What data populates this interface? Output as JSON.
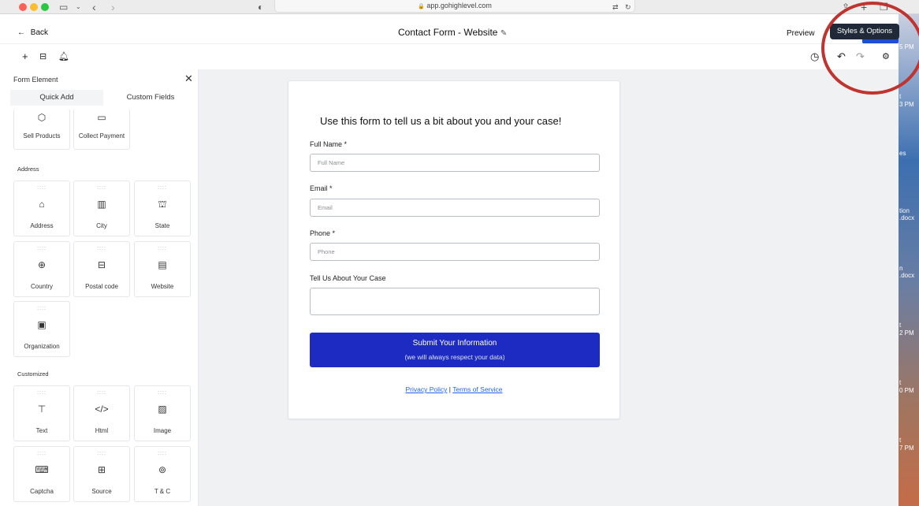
{
  "browser": {
    "url": "app.gohighlevel.com",
    "lock_icon": "🔒"
  },
  "desktop_labels": [
    "5 PM",
    "t",
    "3 PM",
    "es",
    "tion",
    ".docx",
    "n",
    ".docx",
    "t",
    "2 PM",
    "t",
    "0 PM",
    "t",
    "7 PM"
  ],
  "header": {
    "back_label": "Back",
    "title": "Contact Form - Website",
    "preview_label": "Preview",
    "tooltip": "Styles & Options"
  },
  "panel": {
    "title": "Form Element",
    "tabs": [
      "Quick Add",
      "Custom Fields"
    ],
    "top_items": [
      "Sell Products",
      "Collect Payment"
    ],
    "address_section": "Address",
    "address_items": [
      "Address",
      "City",
      "State",
      "Country",
      "Postal code",
      "Website",
      "Organization"
    ],
    "customized_section": "Customized",
    "customized_items": [
      "Text",
      "Html",
      "Image",
      "Captcha",
      "Source",
      "T & C"
    ]
  },
  "form": {
    "heading": "Use this form to tell us a bit about you and your case!",
    "fields": [
      {
        "label": "Full Name *",
        "placeholder": "Full Name"
      },
      {
        "label": "Email *",
        "placeholder": "Email"
      },
      {
        "label": "Phone *",
        "placeholder": "Phone"
      }
    ],
    "case_label": "Tell Us About Your Case",
    "submit_main": "Submit Your Information",
    "submit_sub": "(we will always respect your data)",
    "privacy": "Privacy Policy",
    "separator": "|",
    "terms": "Terms of Service"
  },
  "colors": {
    "submit": "#1e2bc2",
    "accent": "#1d4ed8",
    "highlight_ring": "#c0342f"
  }
}
